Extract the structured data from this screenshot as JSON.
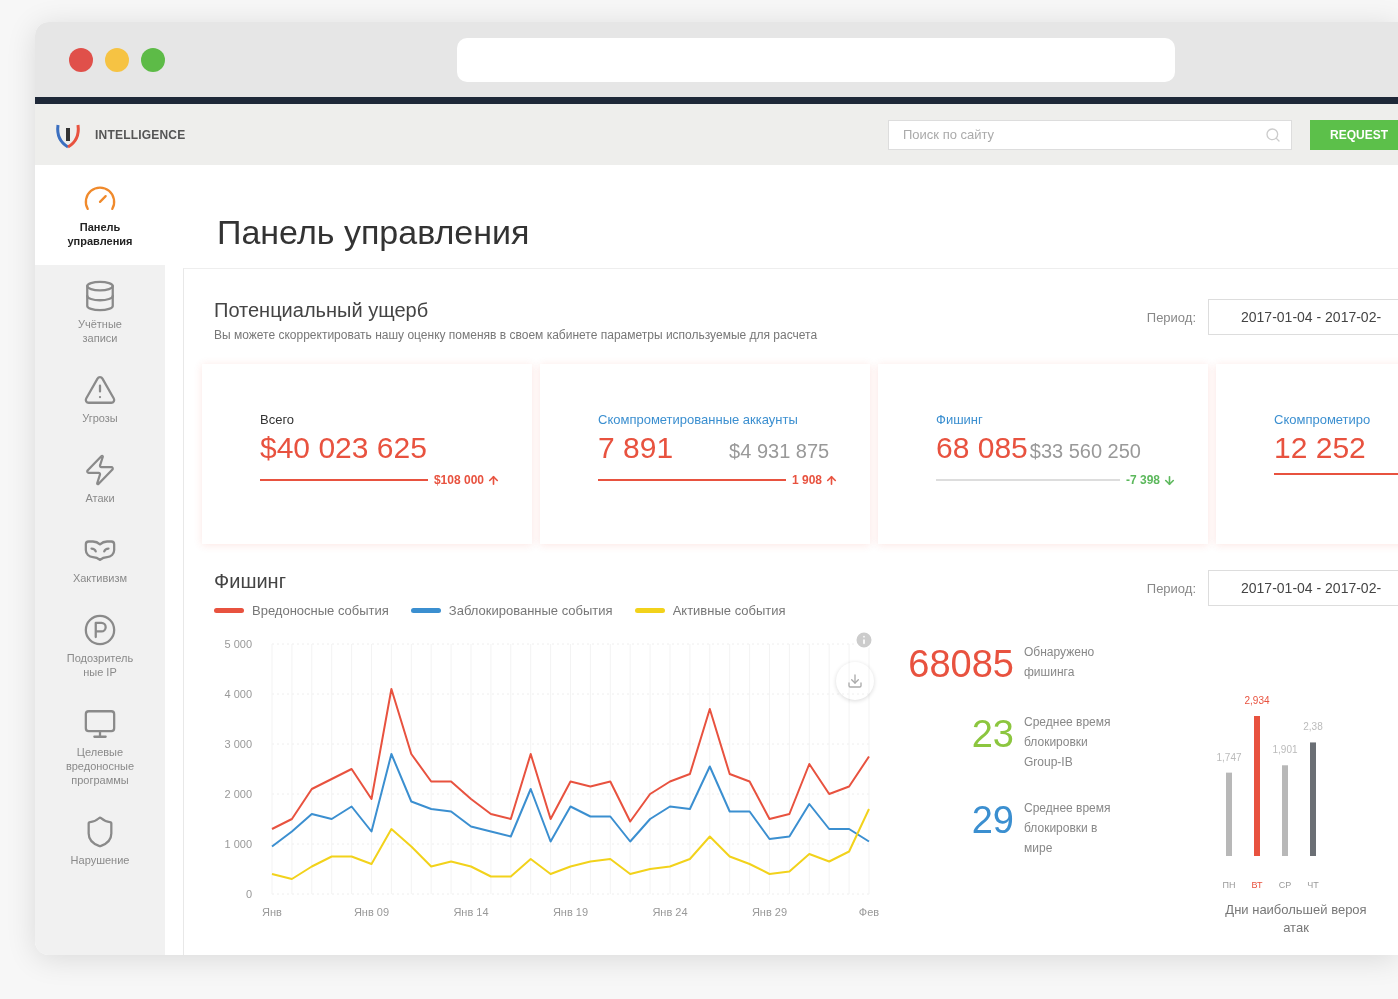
{
  "header": {
    "brand": "INTELLIGENCE",
    "search": {
      "placeholder": "Поиск по сайту"
    },
    "request_button": "REQUEST"
  },
  "sidebar": {
    "items": [
      {
        "kind": "gauge",
        "label": "Панель\nуправления",
        "selected": true
      },
      {
        "kind": "accounts",
        "label": "Учётные\nзаписи",
        "selected": false
      },
      {
        "kind": "threats",
        "label": "Угрозы",
        "selected": false
      },
      {
        "kind": "attacks",
        "label": "Атаки",
        "selected": false
      },
      {
        "kind": "hacktivism",
        "label": "Хактивизм",
        "selected": false
      },
      {
        "kind": "ip",
        "label": "Подозритель\nные IP",
        "selected": false
      },
      {
        "kind": "malware",
        "label": "Целевые\nвредоносные\nпрограммы",
        "selected": false
      },
      {
        "kind": "brand",
        "label": "Нарушение",
        "selected": false
      }
    ]
  },
  "page_title": "Панель управления",
  "damage": {
    "title": "Потенциальный ущерб",
    "subtitle": "Вы можете скорректировать нашу оценку поменяв в своем кабинете параметры используемые для расчета",
    "period_label": "Период:",
    "period_value": "2017-01-04 - 2017-02-",
    "cards": [
      {
        "kind": "total",
        "label": "Всего",
        "value": "$40 023 625",
        "delta": "$108 000",
        "up": true
      },
      {
        "kind": "category",
        "label": "Скомпрометированные аккаунты",
        "value": "7 891",
        "amount": "$4 931 875",
        "delta": "1 908",
        "up": true
      },
      {
        "kind": "category",
        "label": "Фишинг",
        "value": "68 085",
        "amount": "$33 560 250",
        "delta": "-7 398",
        "up": false
      },
      {
        "kind": "category",
        "label": "Скомпрометиро",
        "value": "12 252",
        "up": true
      }
    ]
  },
  "phishing": {
    "title": "Фишинг",
    "period_label": "Период:",
    "period_value": "2017-01-04 - 2017-02-",
    "chart_data": {
      "type": "line",
      "categories": [
        "Янв",
        null,
        null,
        null,
        null,
        "Янв 09",
        null,
        null,
        null,
        null,
        "Янв 14",
        null,
        null,
        null,
        null,
        "Янв 19",
        null,
        null,
        null,
        null,
        "Янв 24",
        null,
        null,
        null,
        null,
        "Янв 29",
        null,
        null,
        null,
        null,
        "Фев"
      ],
      "yticks": [
        {
          "value": 0,
          "label": "0"
        },
        {
          "value": 1000,
          "label": "1 000"
        },
        {
          "value": 2000,
          "label": "2 000"
        },
        {
          "value": 3000,
          "label": "3 000"
        },
        {
          "value": 4000,
          "label": "4 000"
        },
        {
          "value": 5000,
          "label": "5 000"
        }
      ],
      "ylim": [
        0,
        5000
      ],
      "grid": true,
      "series": [
        {
          "name": "Вредоносные события",
          "color": "#e8523f",
          "values": [
            1300,
            1500,
            2100,
            2300,
            2500,
            1900,
            4100,
            2800,
            2250,
            2250,
            1900,
            1600,
            1500,
            2800,
            1500,
            2250,
            2150,
            2250,
            1450,
            2000,
            2250,
            2400,
            3700,
            2400,
            2250,
            1500,
            1600,
            2600,
            2000,
            2150,
            2750
          ]
        },
        {
          "name": "Заблокированные события",
          "color": "#3b8fd0",
          "values": [
            950,
            1250,
            1600,
            1500,
            1750,
            1250,
            2800,
            1850,
            1700,
            1650,
            1350,
            1250,
            1150,
            2100,
            1050,
            1750,
            1550,
            1550,
            1050,
            1500,
            1750,
            1700,
            2550,
            1650,
            1650,
            1100,
            1150,
            1800,
            1300,
            1300,
            1050
          ]
        },
        {
          "name": "Активные события",
          "color": "#f2d21b",
          "values": [
            400,
            300,
            550,
            750,
            750,
            600,
            1300,
            950,
            550,
            650,
            550,
            350,
            350,
            700,
            400,
            550,
            650,
            700,
            400,
            500,
            550,
            700,
            1150,
            750,
            600,
            400,
            450,
            800,
            650,
            850,
            1700
          ]
        }
      ]
    },
    "stats": [
      {
        "value": "68085",
        "label": "Обнаружено\nфишинга",
        "color": "#e8523f"
      },
      {
        "value": "23",
        "label": "Среднее время\nблокировки\nGroup-IB",
        "color": "#8cc63f"
      },
      {
        "value": "29",
        "label": "Среднее время\nблокировки в\nмире",
        "color": "#3b8fd0"
      }
    ],
    "days_chart": {
      "chart_data": {
        "type": "bar",
        "categories": [
          "ПН",
          "ВТ",
          "СР",
          "ЧТ"
        ],
        "values": [
          1747,
          2934,
          1901,
          2380
        ],
        "colors": [
          "#b8b8b8",
          "#e8523f",
          "#b8b8b8",
          "#6b6f75"
        ],
        "value_labels": [
          "1,747",
          "2,934",
          "1,901",
          null
        ]
      },
      "cut_value_label": "2,38",
      "caption": [
        "Дни наибольшей вероя",
        "атак"
      ]
    }
  }
}
